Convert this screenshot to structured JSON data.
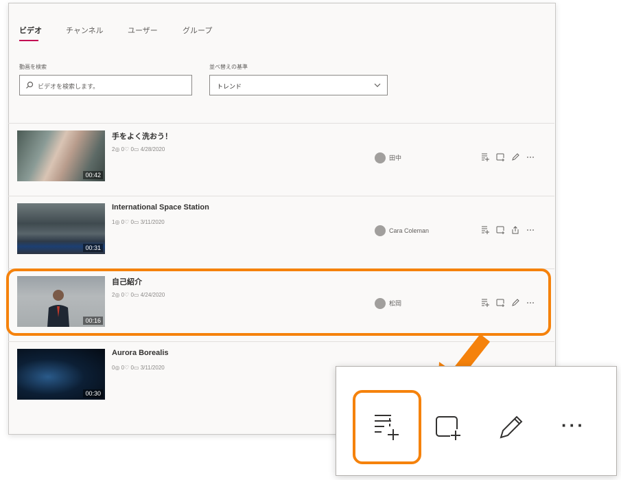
{
  "tabs": [
    "ビデオ",
    "チャンネル",
    "ユーザー",
    "グループ"
  ],
  "search": {
    "label": "動画を検索",
    "placeholder": "ビデオを検索します。",
    "icon": "search-icon"
  },
  "sort": {
    "label": "並べ替えの基準",
    "value": "トレンド",
    "icon": "chevron-down-icon"
  },
  "videos": [
    {
      "title": "手をよく洗おう！",
      "stats": "2◎  0♡  0▭  4/28/2020",
      "duration": "00:42",
      "owner": "田中",
      "actions": [
        "add-to-playlist-icon",
        "add-to-group-icon",
        "edit-icon",
        "more-icon"
      ]
    },
    {
      "title": "International Space Station",
      "stats": "1◎  0♡  0▭  3/11/2020",
      "duration": "00:31",
      "owner": "Cara Coleman",
      "actions": [
        "add-to-playlist-icon",
        "add-to-group-icon",
        "share-icon",
        "more-icon"
      ]
    },
    {
      "title": "自己紹介",
      "stats": "2◎  0♡  0▭  4/24/2020",
      "duration": "00:16",
      "owner": "松岡",
      "actions": [
        "add-to-playlist-icon",
        "add-to-group-icon",
        "edit-icon",
        "more-icon"
      ]
    },
    {
      "title": "Aurora Borealis",
      "stats": "0◎  0♡  0▭  3/11/2020",
      "duration": "00:30",
      "owner": ""
    }
  ],
  "zoom": {
    "more_label": "···"
  },
  "colors": {
    "accent": "#c30052",
    "highlight": "#f5820c"
  }
}
